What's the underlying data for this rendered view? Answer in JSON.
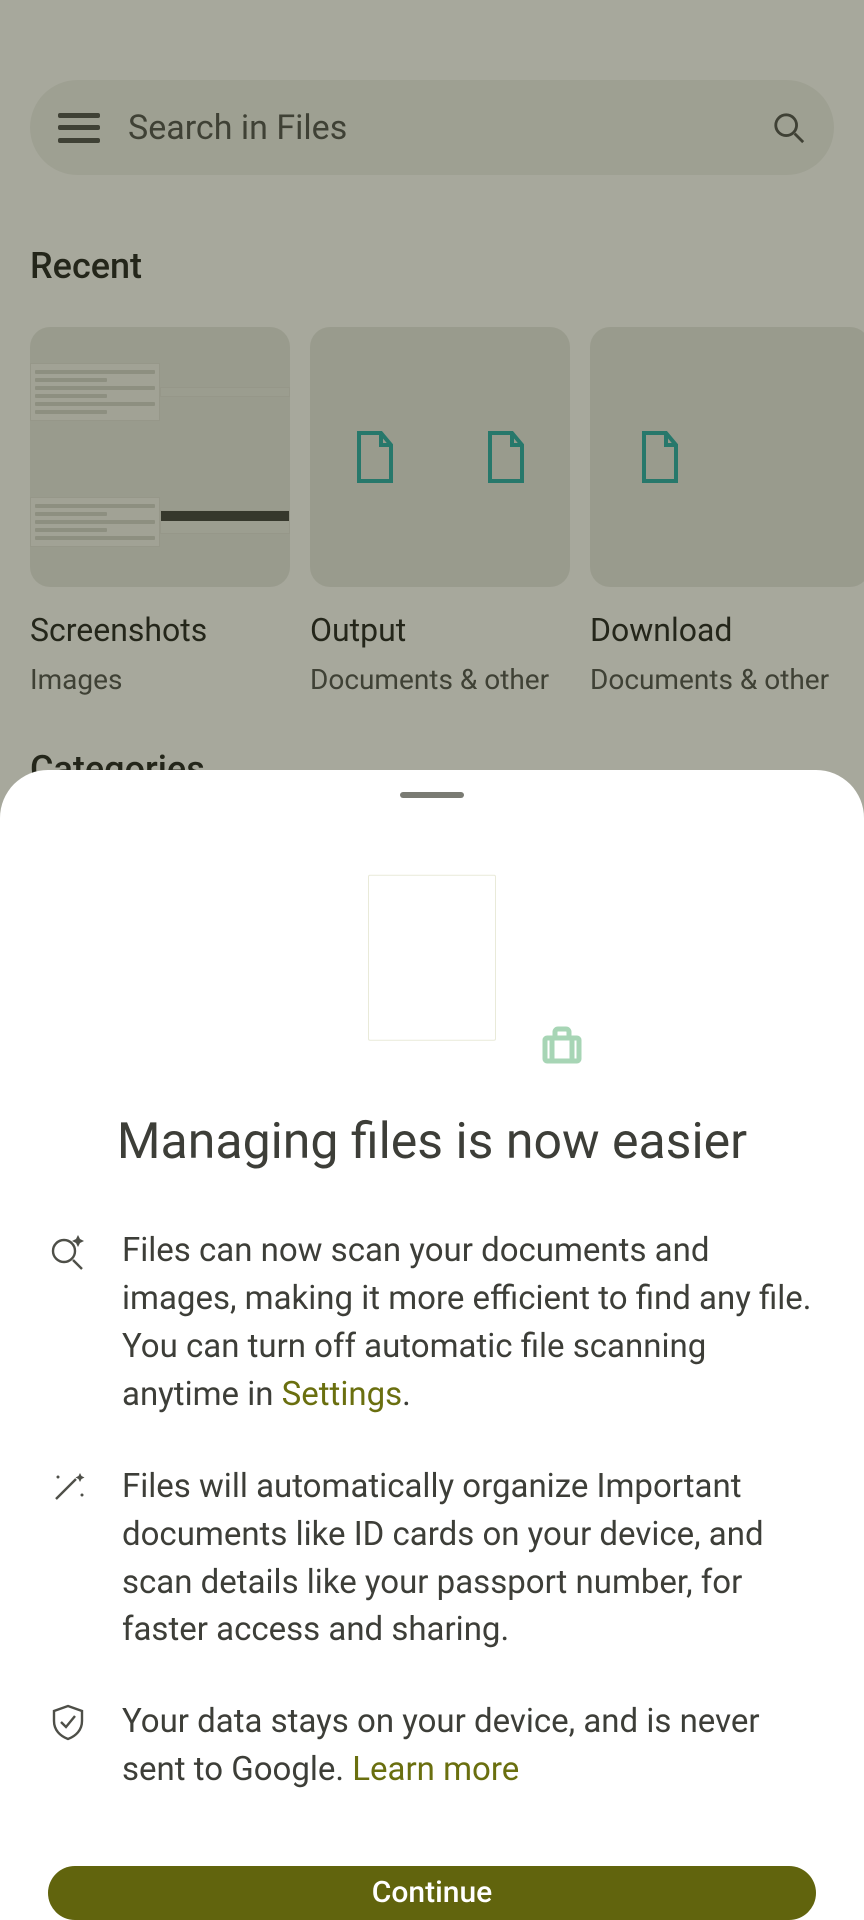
{
  "search": {
    "placeholder": "Search in Files"
  },
  "sections": {
    "recent_title": "Recent",
    "categories_title": "Categories"
  },
  "recent": [
    {
      "name": "Screenshots",
      "sub": "Images"
    },
    {
      "name": "Output",
      "sub": "Documents & other"
    },
    {
      "name": "Download",
      "sub": "Documents & other"
    }
  ],
  "sheet": {
    "title": "Managing files is now easier",
    "points": [
      {
        "text_pre": "Files can now scan your documents and images, making it more efficient to find any file. You can turn off automatic file scanning anytime in ",
        "link": "Settings",
        "text_post": "."
      },
      {
        "text_pre": "Files will automatically organize Important documents like ID cards on your device, and scan details like your passport number, for faster access and sharing.",
        "link": "",
        "text_post": ""
      },
      {
        "text_pre": "Your data stays on your device, and is never sent to Google. ",
        "link": "Learn more",
        "text_post": ""
      }
    ],
    "cta": "Continue"
  }
}
